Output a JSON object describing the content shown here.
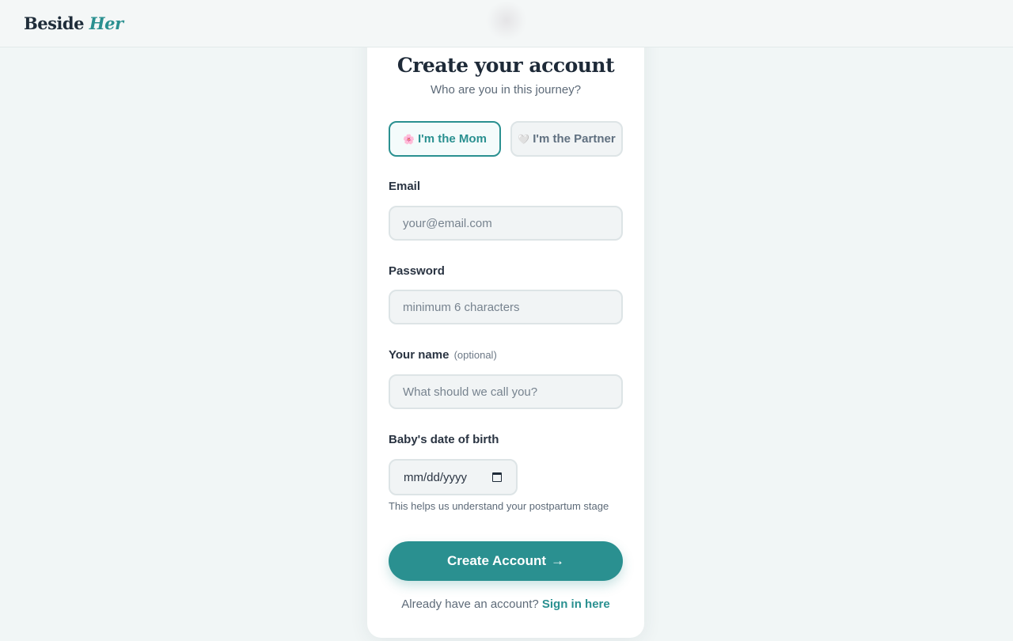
{
  "brand": {
    "name_part1": "Beside",
    "name_part2": "Her"
  },
  "header": {
    "title": "Create your account",
    "subtitle": "Who are you in this journey?"
  },
  "roles": [
    {
      "emoji": "🌸",
      "label": "I'm the Mom",
      "selected": true
    },
    {
      "emoji": "🤍",
      "label": "I'm the Partner",
      "selected": false
    }
  ],
  "form": {
    "email": {
      "label": "Email",
      "placeholder": "your@email.com",
      "value": ""
    },
    "password": {
      "label": "Password",
      "placeholder": "minimum 6 characters",
      "value": ""
    },
    "name": {
      "label": "Your name",
      "optional_tag": "(optional)",
      "placeholder": "What should we call you?",
      "value": ""
    },
    "dob": {
      "label": "Baby's date of birth",
      "value": "mm/dd/yyyy",
      "hint": "This helps us understand your postpartum stage"
    }
  },
  "submit": {
    "label": "Create Account",
    "arrow": "→"
  },
  "footer": {
    "text": "Already have an account?",
    "link": "Sign in here"
  },
  "colors": {
    "accent": "#2a9090",
    "background": "#f1f6f6",
    "text": "#1e2a38"
  },
  "icons": {
    "date_picker": "calendar-icon"
  }
}
